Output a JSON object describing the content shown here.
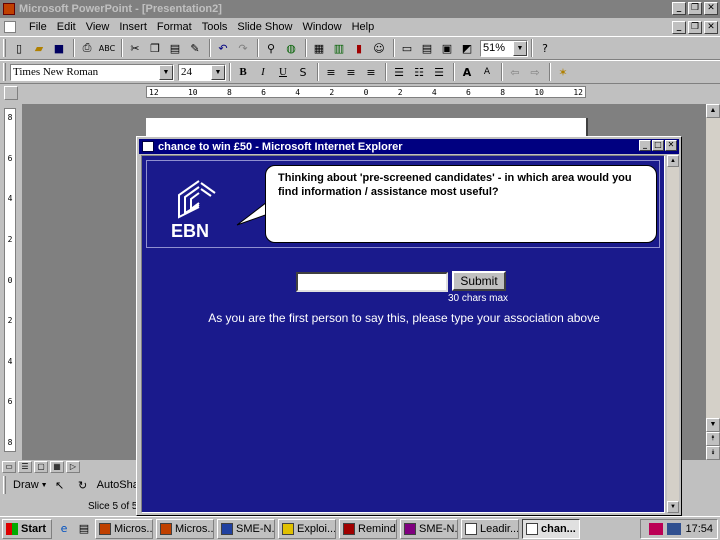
{
  "window": {
    "title": "Microsoft PowerPoint - [Presentation2]",
    "controls": {
      "minimize": "_",
      "restore": "❐",
      "close": "✕"
    }
  },
  "menu": {
    "items": [
      {
        "label": "File"
      },
      {
        "label": "Edit"
      },
      {
        "label": "View"
      },
      {
        "label": "Insert"
      },
      {
        "label": "Format"
      },
      {
        "label": "Tools"
      },
      {
        "label": "Slide Show"
      },
      {
        "label": "Window"
      },
      {
        "label": "Help"
      }
    ]
  },
  "toolbar": {
    "zoom": "51%",
    "font_name": "Times New Roman",
    "font_size": "24",
    "bold": "B",
    "italic": "I",
    "underline": "U",
    "shadow": "S"
  },
  "ruler": {
    "horizontal_ticks": [
      "12",
      "10",
      "8",
      "6",
      "4",
      "2",
      "0",
      "2",
      "4",
      "6",
      "8",
      "10",
      "12"
    ],
    "vertical_ticks": [
      "8",
      "6",
      "4",
      "2",
      "0",
      "2",
      "4",
      "6",
      "8"
    ]
  },
  "drawing_toolbar": {
    "draw_label": "Draw",
    "autoshapes_label": "AutoSha"
  },
  "status": {
    "slide_text": "Slice 5 of 5"
  },
  "popup": {
    "title": "chance to win £50 - Microsoft Internet Explorer",
    "logo_text": "EBN",
    "question": "Thinking about 'pre-screened candidates' - in which area would you find information / assistance most useful?",
    "input": {
      "value": "",
      "placeholder": ""
    },
    "submit_label": "Submit",
    "chars_hint": "30 chars max",
    "instruction": "As you are the first person to say this, please type your association above"
  },
  "taskbar": {
    "start_label": "Start",
    "tasks": [
      {
        "label": "Micros...",
        "icon_color": "#c04000",
        "active": false
      },
      {
        "label": "Micros...",
        "icon_color": "#c04000",
        "active": false
      },
      {
        "label": "SME-N...",
        "icon_color": "#2040a0",
        "active": false
      },
      {
        "label": "Exploi...",
        "icon_color": "#e0c000",
        "active": false
      },
      {
        "label": "Remind...",
        "icon_color": "#a00000",
        "active": false
      },
      {
        "label": "SME-N...",
        "icon_color": "#800080",
        "active": false
      },
      {
        "label": "Leadir...",
        "icon_color": "#ffffff",
        "active": false
      },
      {
        "label": "chan...",
        "icon_color": "#ffffff",
        "active": true
      }
    ],
    "clock": "17:54"
  },
  "colors": {
    "popup_background": "#1a1a8c",
    "title_active": "#000080",
    "title_inactive": "#808080"
  }
}
